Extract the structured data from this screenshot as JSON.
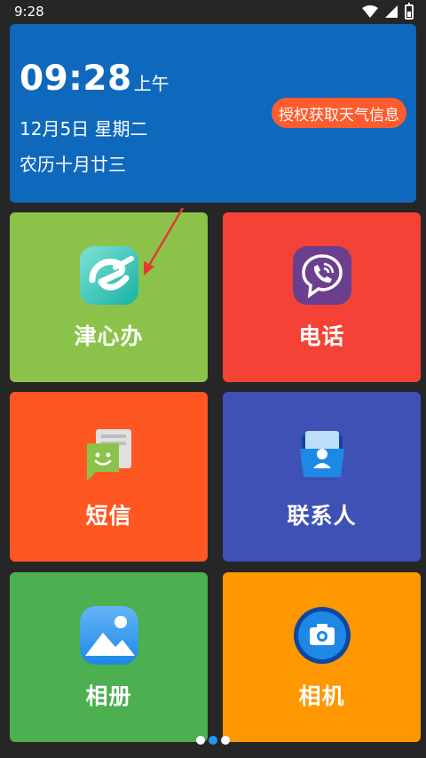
{
  "status_bar": {
    "time": "9:28"
  },
  "clock": {
    "time": "09:28",
    "ampm": "上午",
    "date": "12月5日 星期二",
    "lunar": "农历十月廿三",
    "weather_button": "授权获取天气信息"
  },
  "apps": [
    {
      "label": "津心办",
      "icon": "jinxinban-app-icon",
      "color": "#8bc34a"
    },
    {
      "label": "电话",
      "icon": "phone-viber-icon",
      "color": "#f44336"
    },
    {
      "label": "短信",
      "icon": "sms-message-icon",
      "color": "#ff5722"
    },
    {
      "label": "联系人",
      "icon": "contacts-icon",
      "color": "#3f51b5"
    },
    {
      "label": "相册",
      "icon": "gallery-icon",
      "color": "#4caf50"
    },
    {
      "label": "相机",
      "icon": "camera-icon",
      "color": "#ff9800"
    }
  ],
  "pager": {
    "pages": 3,
    "active_page": 2
  },
  "colors": {
    "background": "#262626",
    "clock_card": "#0e69bd",
    "weather_button": "#fd5c2f",
    "arrow": "#e53935"
  }
}
